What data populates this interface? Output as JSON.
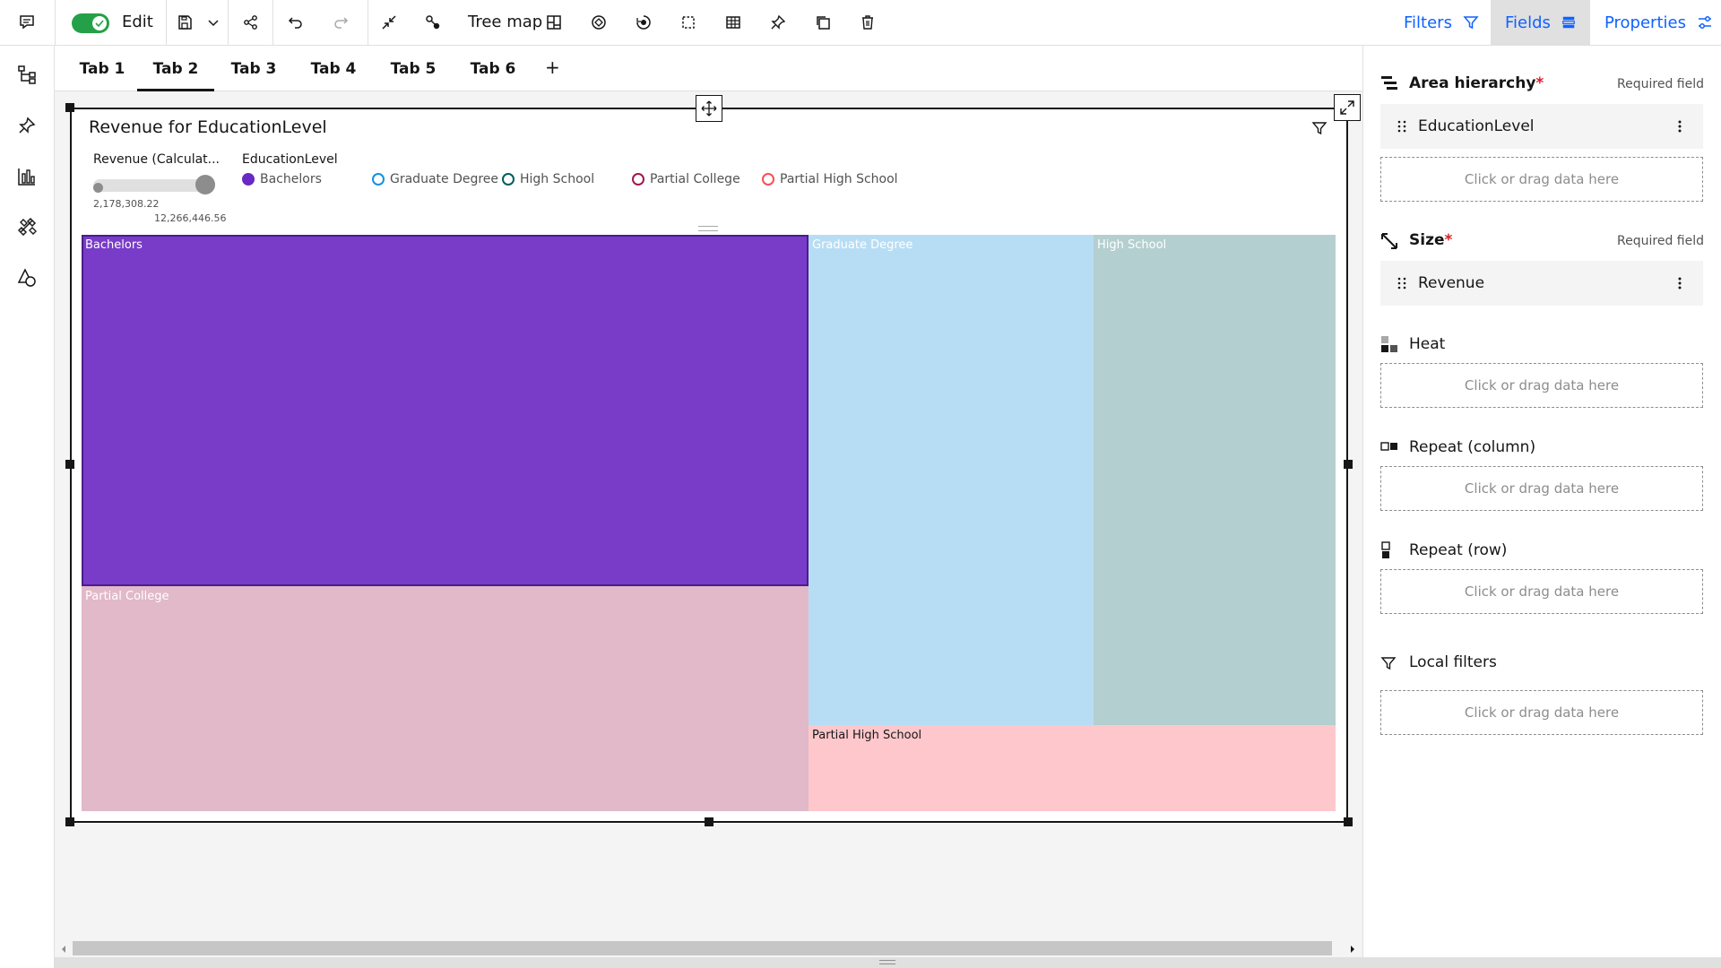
{
  "toolbar": {
    "edit_label": "Edit",
    "edit_toggle_on": true,
    "visualization_type": "Tree map",
    "filters_label": "Filters",
    "fields_label": "Fields",
    "properties_label": "Properties",
    "accent": "#0f62fe",
    "toggle_color": "#24a148"
  },
  "tabs": [
    "Tab 1",
    "Tab 2",
    "Tab 3",
    "Tab 4",
    "Tab 5",
    "Tab 6"
  ],
  "active_tab": "Tab 2",
  "add_tab_label": "+",
  "widget": {
    "title": "Revenue for EducationLevel",
    "size_legend_title": "Revenue (Calculat...",
    "size_min": "2,178,308.22",
    "size_max": "12,266,446.56",
    "color_legend_title": "EducationLevel",
    "legend": [
      {
        "label": "Bachelors",
        "color": "#6929c4",
        "filled": true
      },
      {
        "label": "Graduate Degree",
        "color": "#1192e8",
        "filled": false
      },
      {
        "label": "High School",
        "color": "#005d5d",
        "filled": false
      },
      {
        "label": "Partial College",
        "color": "#9f1853",
        "filled": false
      },
      {
        "label": "Partial High School",
        "color": "#fa4d56",
        "filled": false
      }
    ]
  },
  "chart_data": {
    "type": "treemap",
    "title": "Revenue for EducationLevel",
    "size_measure": "Revenue (Calculat...",
    "size_range": [
      2178308.22,
      12266446.56
    ],
    "categories": [
      "Bachelors",
      "Partial College",
      "Graduate Degree",
      "High School",
      "Partial High School"
    ],
    "values": [
      12266446.56,
      7830000,
      6700000,
      5700000,
      2178308.22
    ],
    "colors": [
      "#783cc8",
      "#e1b9c8",
      "#b7ddf4",
      "#b4cfcf",
      "#fdc7cc"
    ],
    "label_colors": [
      "#ffffff",
      "#ffffff",
      "#ffffff",
      "#ffffff",
      "#161616"
    ],
    "selected": "Bachelors"
  },
  "panel": {
    "area_hierarchy": {
      "title": "Area hierarchy",
      "required": "Required field",
      "field": "EducationLevel"
    },
    "size": {
      "title": "Size",
      "required": "Required field",
      "field": "Revenue"
    },
    "heat": {
      "title": "Heat"
    },
    "repeat_column": {
      "title": "Repeat (column)"
    },
    "repeat_row": {
      "title": "Repeat (row)"
    },
    "local_filters": {
      "title": "Local filters"
    },
    "drop_placeholder": "Click or drag data here",
    "required_star": "*"
  }
}
